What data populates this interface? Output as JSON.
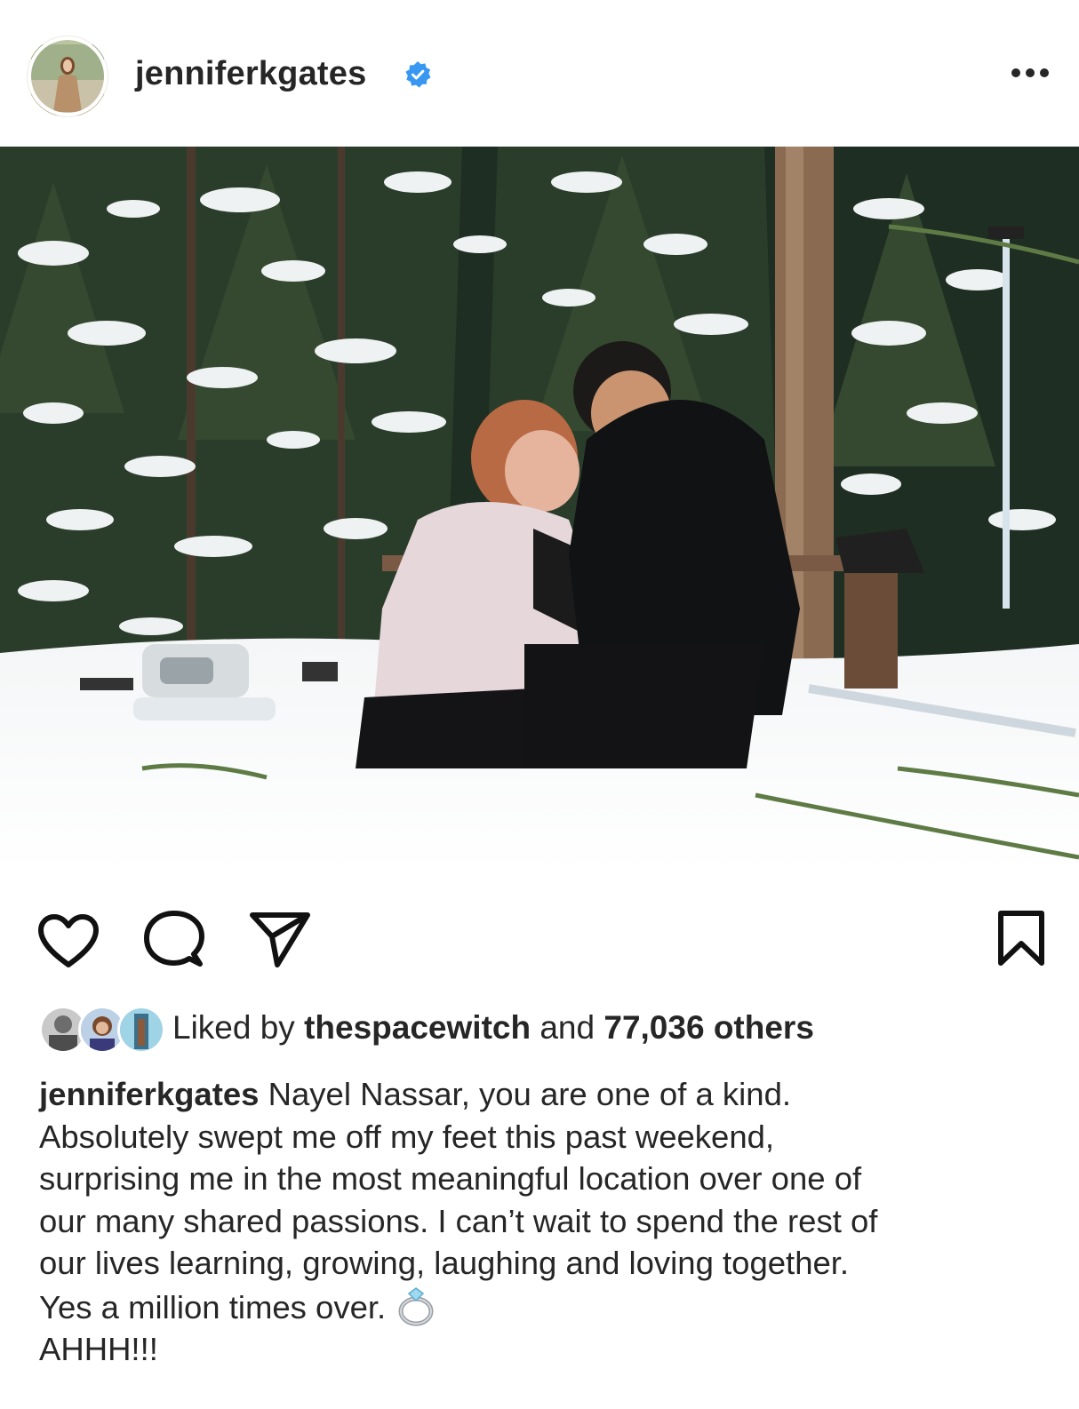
{
  "post": {
    "username": "jenniferkgates",
    "avatar_icon": "profile-photo-avatar",
    "verified_icon": "verified-badge-icon",
    "more_icon": "more-options-icon"
  },
  "actions": {
    "like_icon": "heart-icon",
    "comment_icon": "comment-icon",
    "share_icon": "share-icon",
    "save_icon": "bookmark-icon"
  },
  "likes": {
    "prefix": "Liked by",
    "liker": "thespacewitch",
    "and": "and",
    "count_text": "77,036 others"
  },
  "caption": {
    "username": "jenniferkgates",
    "lines": [
      "Nayel Nassar, you are one of a kind.",
      "Absolutely swept me off my feet this past weekend,",
      "surprising me in the most meaningful location over one of",
      "our many shared passions. I can’t wait to spend the rest of",
      "our lives learning, growing, laughing and loving together.",
      "Yes a million times over.",
      "AHHH!!!"
    ],
    "ring_icon": "ring-emoji-icon"
  },
  "colors": {
    "verified_blue": "#3897f0",
    "text": "#262626"
  }
}
